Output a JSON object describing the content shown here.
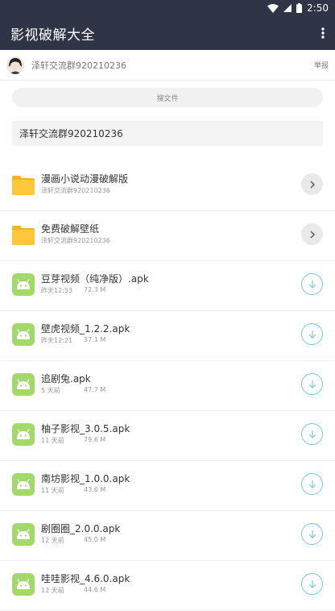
{
  "status_bar": {
    "time": "2:50",
    "icons": [
      "wifi-icon",
      "signal-icon",
      "battery-icon"
    ]
  },
  "app_bar": {
    "title": "影视破解大全",
    "menu_icon": "more-vert-icon"
  },
  "user": {
    "name": "泽轩交流群920210236",
    "report_label": "举报"
  },
  "search": {
    "placeholder": "搜文件"
  },
  "notice": {
    "text": "泽轩交流群920210236"
  },
  "folders": [
    {
      "name": "漫画小说动漫破解版",
      "sub": "泽轩交流群920210236"
    },
    {
      "name": "免费破解壁纸",
      "sub": "泽轩交流群920210236"
    }
  ],
  "files": [
    {
      "name": "豆芽视频（纯净版）.apk",
      "time": "昨天12:53",
      "size": "72.3 M"
    },
    {
      "name": "壁虎视频_1.2.2.apk",
      "time": "昨天12:21",
      "size": "37.1 M"
    },
    {
      "name": "追剧兔.apk",
      "time": "5 天前",
      "size": "47.7 M"
    },
    {
      "name": "柚子影视_3.0.5.apk",
      "time": "11 天前",
      "size": "79.6 M"
    },
    {
      "name": "南坊影视_1.0.0.apk",
      "time": "11 天前",
      "size": "43.6 M"
    },
    {
      "name": "剧圈圈_2.0.0.apk",
      "time": "12 天前",
      "size": "45.0 M"
    },
    {
      "name": "哇哇影视_4.6.0.apk",
      "time": "12 天前",
      "size": "44.6 M"
    }
  ],
  "colors": {
    "app_bar": "#2f3447",
    "folder": "#fdc63d",
    "apk_icon": "#a3d86a",
    "download": "#73c7e9"
  }
}
